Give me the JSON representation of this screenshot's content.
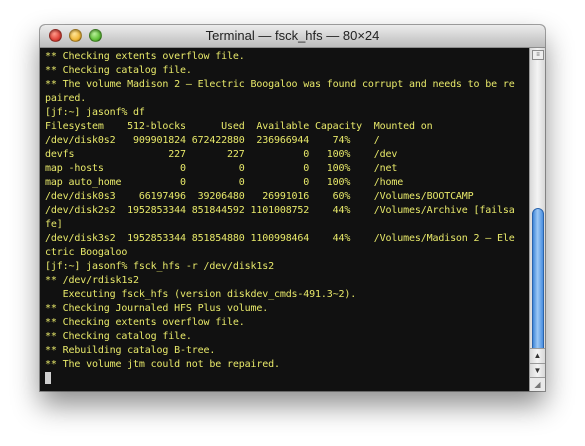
{
  "window": {
    "title": "Terminal — fsck_hfs — 80×24"
  },
  "terminal": {
    "lines": [
      "** Checking extents overflow file.",
      "** Checking catalog file.",
      "** The volume Madison 2 – Electric Boogaloo was found corrupt and needs to be re",
      "paired.",
      "[jf:~] jasonf% df",
      "Filesystem    512-blocks      Used  Available Capacity  Mounted on",
      "/dev/disk0s2   909901824 672422880  236966944    74%    /",
      "devfs                227       227          0   100%    /dev",
      "map -hosts             0         0          0   100%    /net",
      "map auto_home          0         0          0   100%    /home",
      "/dev/disk0s3    66197496  39206480   26991016    60%    /Volumes/BOOTCAMP",
      "/dev/disk2s2  1952853344 851844592 1101008752    44%    /Volumes/Archive [failsa",
      "fe]",
      "/dev/disk3s2  1952853344 851854880 1100998464    44%    /Volumes/Madison 2 – Ele",
      "ctric Boogaloo",
      "[jf:~] jasonf% fsck_hfs -r /dev/disk1s2",
      "** /dev/rdisk1s2",
      "   Executing fsck_hfs (version diskdev_cmds-491.3~2).",
      "** Checking Journaled HFS Plus volume.",
      "** Checking extents overflow file.",
      "** Checking catalog file.",
      "** Rebuilding catalog B-tree.",
      "** The volume jtm could not be repaired."
    ]
  },
  "colors": {
    "terminal_text": "#e8e96a",
    "terminal_background": "#111111",
    "scroll_thumb": "#4a8fe0"
  }
}
